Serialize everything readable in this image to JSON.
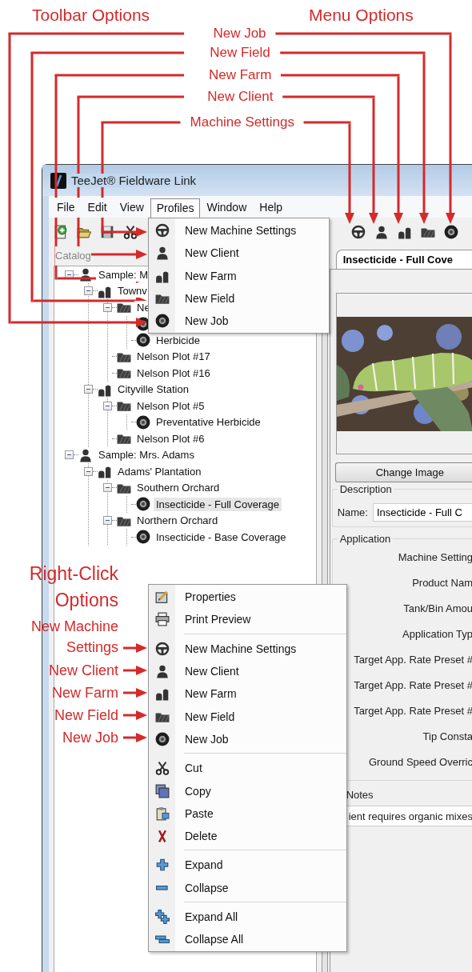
{
  "annotations": {
    "toolbar_heading": "Toolbar Options",
    "menu_heading": "Menu Options",
    "callouts": [
      "New Job",
      "New Field",
      "New Farm",
      "New Client",
      "Machine Settings"
    ],
    "right_click_heading": "Right-Click Options",
    "right_click_callouts": [
      "New Machine Settings",
      "New Client",
      "New Farm",
      "New Field",
      "New Job"
    ]
  },
  "window": {
    "title": "TeeJet® Fieldware Link",
    "menubar": [
      {
        "label": "File",
        "selected": false
      },
      {
        "label": "Edit",
        "selected": false
      },
      {
        "label": "View",
        "selected": false
      },
      {
        "label": "Profiles",
        "selected": true
      },
      {
        "label": "Window",
        "selected": false
      },
      {
        "label": "Help",
        "selected": false
      }
    ],
    "toolbar_left": [
      {
        "kind": "new"
      },
      {
        "kind": "open"
      },
      {
        "kind": "save"
      },
      {
        "kind": "cut"
      }
    ],
    "toolbar_right": [
      {
        "kind": "machine"
      },
      {
        "kind": "client"
      },
      {
        "kind": "farm"
      },
      {
        "kind": "field"
      },
      {
        "kind": "job"
      }
    ]
  },
  "profiles_menu": [
    {
      "kind": "machine",
      "label": "New Machine Settings"
    },
    {
      "kind": "client",
      "label": "New Client"
    },
    {
      "kind": "farm",
      "label": "New Farm"
    },
    {
      "kind": "field",
      "label": "New Field"
    },
    {
      "kind": "job",
      "label": "New Job"
    }
  ],
  "catalog": {
    "title": "Catalog",
    "tree": [
      {
        "kind": "client",
        "label": "Sample: M",
        "expanded": true,
        "selected": false,
        "children": [
          {
            "kind": "farm",
            "label": "Townv",
            "expanded": true,
            "selected": false,
            "children": [
              {
                "kind": "field",
                "label": "Ne",
                "expanded": true,
                "selected": false,
                "children": [
                  {
                    "kind": "job",
                    "selected": false
                  },
                  {
                    "kind": "job",
                    "label": "Herbicide",
                    "selected": false
                  }
                ]
              },
              {
                "kind": "field",
                "label": "Nelson Plot #17",
                "selected": false
              },
              {
                "kind": "field",
                "label": "Nelson Plot #16",
                "selected": false
              }
            ]
          },
          {
            "kind": "farm",
            "label": "Cityville Station",
            "expanded": true,
            "selected": false,
            "children": [
              {
                "kind": "field",
                "label": "Nelson Plot #5",
                "expanded": true,
                "selected": false,
                "children": [
                  {
                    "kind": "job",
                    "label": "Preventative Herbicide",
                    "selected": false
                  }
                ]
              },
              {
                "kind": "field",
                "label": "Nelson Plot #6",
                "selected": false
              }
            ]
          }
        ]
      },
      {
        "kind": "client",
        "label": "Sample: Mrs. Adams",
        "expanded": true,
        "selected": false,
        "children": [
          {
            "kind": "farm",
            "label": "Adams' Plantation",
            "expanded": true,
            "selected": false,
            "children": [
              {
                "kind": "field",
                "label": "Southern Orchard",
                "expanded": true,
                "selected": false,
                "children": [
                  {
                    "kind": "job",
                    "label": "Insecticide - Full Coverage",
                    "selected": true
                  }
                ]
              },
              {
                "kind": "field",
                "label": "Northern Orchard",
                "expanded": true,
                "selected": false,
                "children": [
                  {
                    "kind": "job",
                    "label": "Insecticide - Base Coverage",
                    "selected": false
                  }
                ]
              }
            ]
          }
        ]
      }
    ]
  },
  "detail": {
    "tab": "Insecticide - Full Cove",
    "change_image": "Change Image",
    "description": {
      "title": "Description",
      "name_label": "Name:",
      "name_value": "Insecticide - Full C"
    },
    "application": {
      "title": "Application",
      "fields": [
        "Machine Setting",
        "Product Nam",
        "Tank/Bin Amou",
        "Application Typ",
        "Target App. Rate Preset #",
        "Target App. Rate Preset #",
        "Target App. Rate Preset #",
        "Tip Consta",
        "Ground Speed Overric"
      ]
    },
    "notes": {
      "title": "Notes",
      "text": "ient requires organic mixes"
    }
  },
  "context_menu": [
    [
      {
        "kind": "properties",
        "label": "Properties"
      },
      {
        "kind": "print",
        "label": "Print Preview"
      }
    ],
    [
      {
        "kind": "machine",
        "label": "New Machine Settings"
      },
      {
        "kind": "client",
        "label": "New Client"
      },
      {
        "kind": "farm",
        "label": "New Farm"
      },
      {
        "kind": "field",
        "label": "New Field"
      },
      {
        "kind": "job",
        "label": "New Job"
      }
    ],
    [
      {
        "kind": "cut",
        "label": "Cut"
      },
      {
        "kind": "copy",
        "label": "Copy"
      },
      {
        "kind": "paste",
        "label": "Paste"
      },
      {
        "kind": "delete",
        "label": "Delete"
      }
    ],
    [
      {
        "kind": "expand",
        "label": "Expand"
      },
      {
        "kind": "collapse",
        "label": "Collapse"
      }
    ],
    [
      {
        "kind": "expand_all",
        "label": "Expand All"
      },
      {
        "kind": "collapse_all",
        "label": "Collapse All"
      }
    ]
  ]
}
